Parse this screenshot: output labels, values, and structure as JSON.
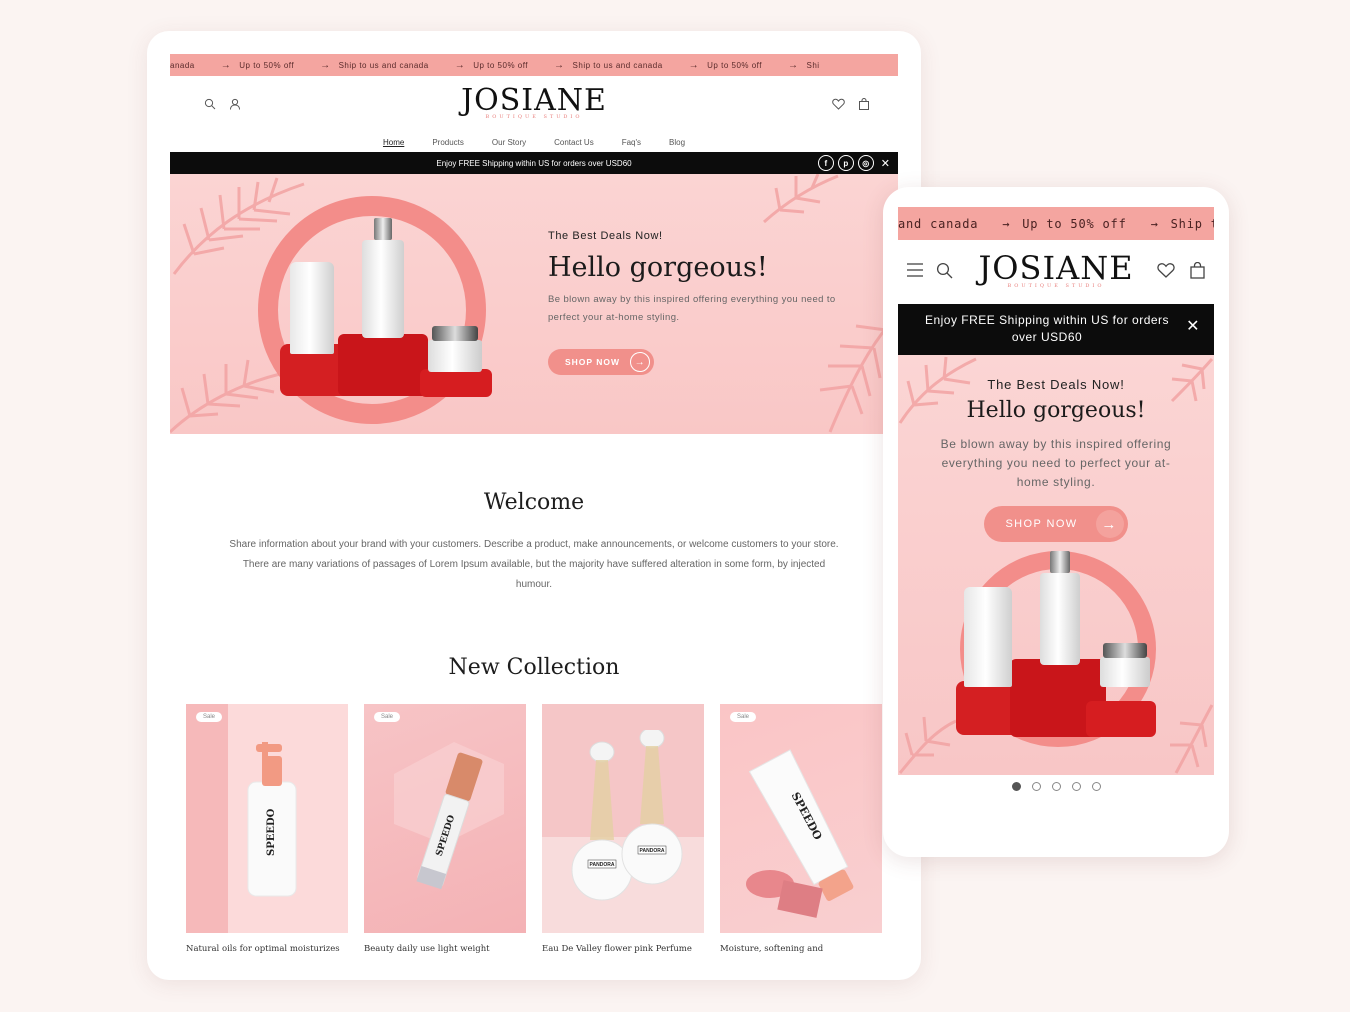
{
  "desktop": {
    "marquee": [
      "anada",
      "Up to 50% off",
      "Ship to us and canada",
      "Up to 50% off",
      "Ship to us and canada",
      "Up to 50% off",
      "Shi"
    ],
    "logo": {
      "word": "JOSIANE",
      "sub": "BOUTIQUE STUDIO"
    },
    "nav": [
      "Home",
      "Products",
      "Our Story",
      "Contact Us",
      "Faq's",
      "Blog"
    ],
    "announcement": "Enjoy FREE Shipping within US for orders over USD60",
    "social": [
      "f",
      "p",
      "◎"
    ],
    "hero": {
      "kicker": "The Best Deals Now!",
      "title": "Hello gorgeous!",
      "body": "Be blown away by this inspired offering everything you need to perfect your at-home styling.",
      "button": "SHOP NOW"
    },
    "welcome": {
      "title": "Welcome",
      "body": "Share information about your brand with your customers. Describe a product, make announcements, or welcome customers to your store. There are many variations of passages of Lorem Ipsum available, but the majority have suffered alteration in some form, by injected humour."
    },
    "collection_title": "New Collection",
    "products": [
      {
        "name": "Natural oils for optimal moisturizes",
        "badge": "Sale",
        "label": "SPEEDO"
      },
      {
        "name": "Beauty daily use light weight",
        "badge": "Sale",
        "label": "SPEEDO"
      },
      {
        "name": "Eau De Valley flower pink Perfume",
        "badge": "",
        "label": "PANDORA"
      },
      {
        "name": "Moisture, softening and",
        "badge": "Sale",
        "label": "SPEEDO"
      }
    ]
  },
  "mobile": {
    "marquee": [
      "and canada",
      "Up to 50% off",
      "Ship to"
    ],
    "logo": {
      "word": "JOSIANE",
      "sub": "BOUTIQUE STUDIO"
    },
    "announcement": "Enjoy FREE Shipping within US for orders over USD60",
    "hero": {
      "kicker": "The Best Deals Now!",
      "title": "Hello gorgeous!",
      "body": "Be blown away by this inspired offering everything you need to perfect your at-home styling.",
      "button": "SHOP NOW"
    },
    "slides": {
      "count": 5,
      "active": 1
    }
  },
  "colors": {
    "accent": "#f1908b",
    "marquee": "#f4a5a0",
    "hero": "#fbd4d3",
    "pedestal": "#d41f22",
    "bar": "#0c0c0c"
  },
  "icons": [
    "search-icon",
    "user-icon",
    "heart-icon",
    "bag-icon",
    "menu-icon",
    "close-icon",
    "arrow-right-icon"
  ]
}
